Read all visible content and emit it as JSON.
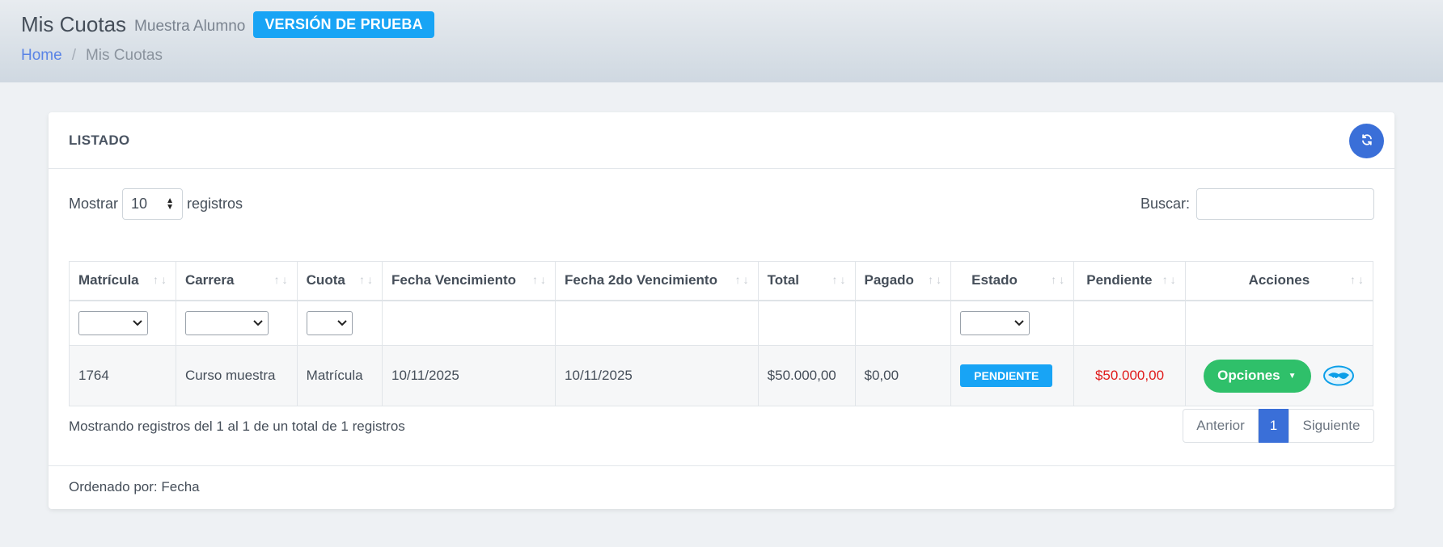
{
  "header": {
    "title": "Mis Cuotas",
    "subtitle": "Muestra Alumno",
    "badge": "VERSIÓN DE PRUEBA",
    "breadcrumb": {
      "home": "Home",
      "separator": "/",
      "current": "Mis Cuotas"
    }
  },
  "card": {
    "title": "LISTADO",
    "refresh_icon": "refresh-icon",
    "length": {
      "prefix": "Mostrar",
      "value": "10",
      "suffix": "registros"
    },
    "search": {
      "label": "Buscar:",
      "value": "",
      "placeholder": ""
    },
    "table": {
      "columns": [
        "Matrícula",
        "Carrera",
        "Cuota",
        "Fecha Vencimiento",
        "Fecha 2do Vencimiento",
        "Total",
        "Pagado",
        "Estado",
        "Pendiente",
        "Acciones"
      ],
      "sort_glyph": "↑↓",
      "rows": [
        {
          "matricula": "1764",
          "carrera": "Curso muestra",
          "cuota": "Matrícula",
          "fecha_vencimiento": "10/11/2025",
          "fecha_2do_vencimiento": "10/11/2025",
          "total": "$50.000,00",
          "pagado": "$0,00",
          "estado": "PENDIENTE",
          "pendiente": "$50.000,00",
          "acciones_label": "Opciones",
          "payment_icon": "mercadopago-handshake-icon"
        }
      ]
    },
    "info": "Mostrando registros del 1 al 1 de un total de 1 registros",
    "pagination": {
      "prev": "Anterior",
      "current": "1",
      "next": "Siguiente"
    },
    "footer": "Ordenado por: Fecha"
  },
  "colors": {
    "accent_blue": "#3a6fd8",
    "badge_blue": "#18a4f5",
    "success_green": "#2fc06a",
    "danger_red": "#e01b1b"
  }
}
